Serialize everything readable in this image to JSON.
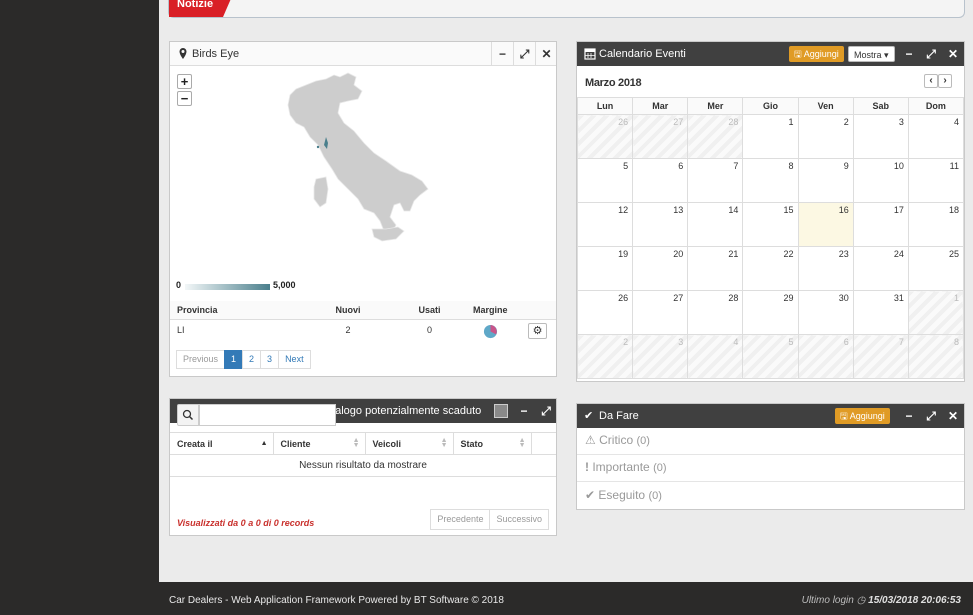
{
  "notizie": {
    "label": "Notizie"
  },
  "birds_eye": {
    "title": "Birds Eye",
    "zoom_in": "+",
    "zoom_out": "−",
    "legend": {
      "min": "0",
      "max": "5,000"
    },
    "columns": [
      "Provincia",
      "Nuovi",
      "Usati",
      "Margine"
    ],
    "rows": [
      {
        "provincia": "LI",
        "nuovi": "2",
        "usati": "0"
      }
    ],
    "pager": {
      "prev": "Previous",
      "pages": [
        "1",
        "2",
        "3"
      ],
      "next": "Next",
      "active": "1"
    }
  },
  "calendar": {
    "title": "Calendario Eventi",
    "add_label": "Aggiungi",
    "show_label": "Mostra",
    "month": "Marzo 2018",
    "days": [
      "Lun",
      "Mar",
      "Mer",
      "Gio",
      "Ven",
      "Sab",
      "Dom"
    ],
    "weeks": [
      [
        {
          "d": "26",
          "o": true
        },
        {
          "d": "27",
          "o": true
        },
        {
          "d": "28",
          "o": true
        },
        {
          "d": "1"
        },
        {
          "d": "2"
        },
        {
          "d": "3"
        },
        {
          "d": "4"
        }
      ],
      [
        {
          "d": "5"
        },
        {
          "d": "6"
        },
        {
          "d": "7"
        },
        {
          "d": "8"
        },
        {
          "d": "9"
        },
        {
          "d": "10"
        },
        {
          "d": "11"
        }
      ],
      [
        {
          "d": "12"
        },
        {
          "d": "13"
        },
        {
          "d": "14"
        },
        {
          "d": "15"
        },
        {
          "d": "16",
          "t": true
        },
        {
          "d": "17"
        },
        {
          "d": "18"
        }
      ],
      [
        {
          "d": "19"
        },
        {
          "d": "20"
        },
        {
          "d": "21"
        },
        {
          "d": "22"
        },
        {
          "d": "23"
        },
        {
          "d": "24"
        },
        {
          "d": "25"
        }
      ],
      [
        {
          "d": "26"
        },
        {
          "d": "27"
        },
        {
          "d": "28"
        },
        {
          "d": "29"
        },
        {
          "d": "30"
        },
        {
          "d": "31"
        },
        {
          "d": "1",
          "o": true
        }
      ],
      [
        {
          "d": "2",
          "o": true
        },
        {
          "d": "3",
          "o": true
        },
        {
          "d": "4",
          "o": true
        },
        {
          "d": "5",
          "o": true
        },
        {
          "d": "6",
          "o": true
        },
        {
          "d": "7",
          "o": true
        },
        {
          "d": "8",
          "o": true
        }
      ]
    ]
  },
  "vendite": {
    "title": "Vendite con Veicoli da un Catalogo potenzialmente scaduto",
    "columns": [
      "Creata il",
      "Cliente",
      "Veicoli",
      "Stato"
    ],
    "empty": "Nessun risultato da mostrare",
    "info": "Visualizzati da 0 a 0 di 0 records",
    "prev": "Precedente",
    "next": "Successivo"
  },
  "todo": {
    "title": "Da Fare",
    "add_label": "Aggiungi",
    "items": [
      {
        "label": "Critico",
        "count": "(0)"
      },
      {
        "label": "Importante",
        "count": "(0)"
      },
      {
        "label": "Eseguito",
        "count": "(0)"
      }
    ]
  },
  "footer": {
    "left": "Car Dealers - Web Application Framework Powered by BT Software © 2018",
    "last_login_label": "Ultimo login",
    "last_login_value": "15/03/2018 20:06:53"
  }
}
